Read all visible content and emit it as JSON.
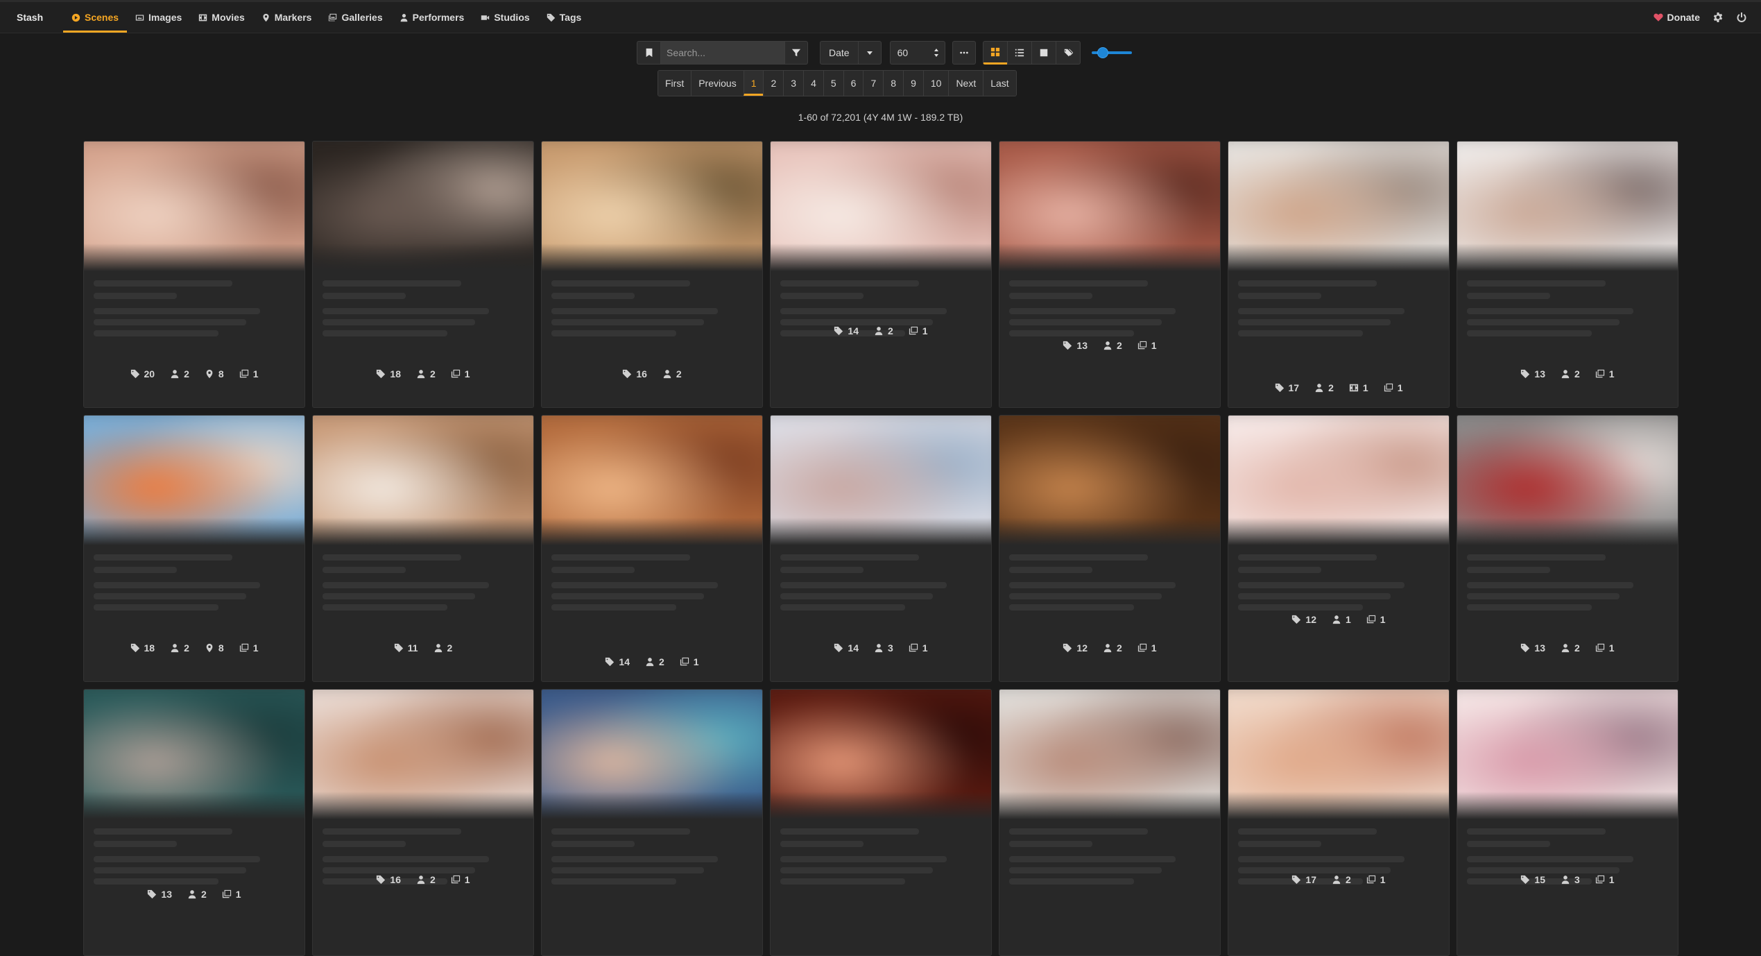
{
  "nav": {
    "brand": "Stash",
    "items": [
      {
        "label": "Scenes",
        "icon": "play-circle-icon",
        "active": true
      },
      {
        "label": "Images",
        "icon": "image-icon",
        "active": false
      },
      {
        "label": "Movies",
        "icon": "film-icon",
        "active": false
      },
      {
        "label": "Markers",
        "icon": "map-marker-icon",
        "active": false
      },
      {
        "label": "Galleries",
        "icon": "images-icon",
        "active": false
      },
      {
        "label": "Performers",
        "icon": "user-icon",
        "active": false
      },
      {
        "label": "Studios",
        "icon": "video-icon",
        "active": false
      },
      {
        "label": "Tags",
        "icon": "tag-icon",
        "active": false
      }
    ],
    "donate_label": "Donate"
  },
  "toolbar": {
    "search_placeholder": "Search...",
    "sort_by": "Date",
    "per_page": "60",
    "display_mode": "grid"
  },
  "pagination": {
    "first": "First",
    "previous": "Previous",
    "pages": [
      "1",
      "2",
      "3",
      "4",
      "5",
      "6",
      "7",
      "8",
      "9",
      "10"
    ],
    "current": "1",
    "next": "Next",
    "last": "Last"
  },
  "summary": "1-60 of 72,201 (4Y 4M 1W - 189.2 TB)",
  "accent_color": "#f5a623",
  "scenes": [
    {
      "counts": [
        {
          "type": "tag",
          "value": "20"
        },
        {
          "type": "performer",
          "value": "2"
        },
        {
          "type": "marker",
          "value": "8"
        },
        {
          "type": "gallery",
          "value": "1"
        }
      ]
    },
    {
      "counts": [
        {
          "type": "tag",
          "value": "18"
        },
        {
          "type": "performer",
          "value": "2"
        },
        {
          "type": "gallery",
          "value": "1"
        }
      ]
    },
    {
      "counts": [
        {
          "type": "tag",
          "value": "16"
        },
        {
          "type": "performer",
          "value": "2"
        }
      ]
    },
    {
      "counts": [
        {
          "type": "tag",
          "value": "14"
        },
        {
          "type": "performer",
          "value": "2"
        },
        {
          "type": "gallery",
          "value": "1"
        }
      ]
    },
    {
      "counts": [
        {
          "type": "tag",
          "value": "13"
        },
        {
          "type": "performer",
          "value": "2"
        },
        {
          "type": "gallery",
          "value": "1"
        }
      ]
    },
    {
      "counts": [
        {
          "type": "tag",
          "value": "17"
        },
        {
          "type": "performer",
          "value": "2"
        },
        {
          "type": "movie",
          "value": "1"
        },
        {
          "type": "gallery",
          "value": "1"
        }
      ]
    },
    {
      "counts": [
        {
          "type": "tag",
          "value": "13"
        },
        {
          "type": "performer",
          "value": "2"
        },
        {
          "type": "gallery",
          "value": "1"
        }
      ]
    },
    {
      "counts": [
        {
          "type": "tag",
          "value": "18"
        },
        {
          "type": "performer",
          "value": "2"
        },
        {
          "type": "marker",
          "value": "8"
        },
        {
          "type": "gallery",
          "value": "1"
        }
      ]
    },
    {
      "counts": [
        {
          "type": "tag",
          "value": "11"
        },
        {
          "type": "performer",
          "value": "2"
        }
      ]
    },
    {
      "counts": [
        {
          "type": "tag",
          "value": "14"
        },
        {
          "type": "performer",
          "value": "2"
        },
        {
          "type": "gallery",
          "value": "1"
        }
      ]
    },
    {
      "counts": [
        {
          "type": "tag",
          "value": "14"
        },
        {
          "type": "performer",
          "value": "3"
        },
        {
          "type": "gallery",
          "value": "1"
        }
      ]
    },
    {
      "counts": [
        {
          "type": "tag",
          "value": "12"
        },
        {
          "type": "performer",
          "value": "2"
        },
        {
          "type": "gallery",
          "value": "1"
        }
      ]
    },
    {
      "counts": [
        {
          "type": "tag",
          "value": "12"
        },
        {
          "type": "performer",
          "value": "1"
        },
        {
          "type": "gallery",
          "value": "1"
        }
      ]
    },
    {
      "counts": [
        {
          "type": "tag",
          "value": "13"
        },
        {
          "type": "performer",
          "value": "2"
        },
        {
          "type": "gallery",
          "value": "1"
        }
      ]
    },
    {
      "counts": [
        {
          "type": "tag",
          "value": "13"
        },
        {
          "type": "performer",
          "value": "2"
        },
        {
          "type": "gallery",
          "value": "1"
        }
      ]
    },
    {
      "counts": [
        {
          "type": "tag",
          "value": "16"
        },
        {
          "type": "performer",
          "value": "2"
        },
        {
          "type": "gallery",
          "value": "1"
        }
      ]
    },
    {
      "counts": []
    },
    {
      "counts": []
    },
    {
      "counts": []
    },
    {
      "counts": [
        {
          "type": "tag",
          "value": "17"
        },
        {
          "type": "performer",
          "value": "2"
        },
        {
          "type": "gallery",
          "value": "1"
        }
      ]
    },
    {
      "counts": [
        {
          "type": "tag",
          "value": "15"
        },
        {
          "type": "performer",
          "value": "3"
        },
        {
          "type": "gallery",
          "value": "1"
        }
      ]
    }
  ]
}
